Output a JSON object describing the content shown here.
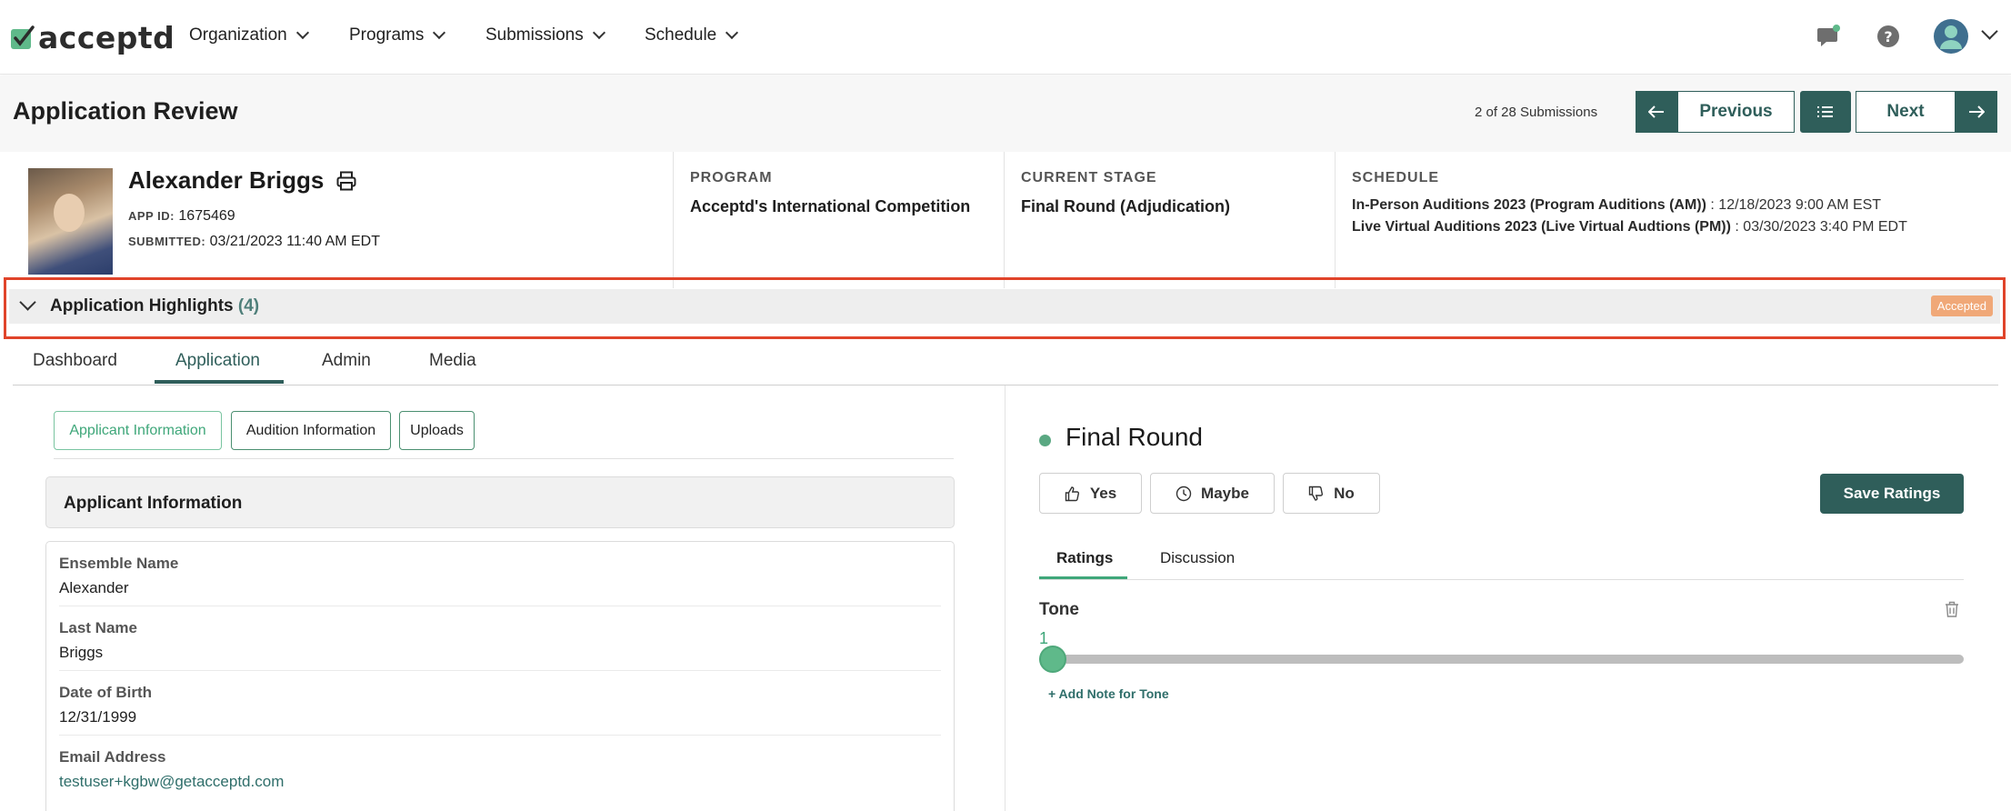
{
  "brand": {
    "name": "acceptd",
    "accent": "#2f5e5a",
    "check_color": "#5fb98a"
  },
  "nav": {
    "items": [
      "Organization",
      "Programs",
      "Submissions",
      "Schedule"
    ]
  },
  "header": {
    "title": "Application Review",
    "submission_count": "2 of 28 Submissions",
    "previous_label": "Previous",
    "next_label": "Next"
  },
  "applicant": {
    "name": "Alexander Briggs",
    "app_id_label": "APP ID:",
    "app_id": "1675469",
    "submitted_label": "SUBMITTED:",
    "submitted": "03/21/2023 11:40 AM EDT"
  },
  "program": {
    "label": "PROGRAM",
    "value": "Acceptd's International Competition"
  },
  "stage": {
    "label": "CURRENT STAGE",
    "value": "Final Round (Adjudication)"
  },
  "schedule": {
    "label": "SCHEDULE",
    "lines": [
      {
        "event": "In-Person Auditions 2023 (Program Auditions (AM))",
        "time": " : 12/18/2023 9:00 AM EST"
      },
      {
        "event": "Live Virtual Auditions 2023 (Live Virtual Audtions (PM))",
        "time": " : 03/30/2023 3:40 PM EDT"
      }
    ]
  },
  "highlights": {
    "title": "Application Highlights",
    "count": "(4)",
    "badge": "Accepted",
    "badge_color": "#f0a878"
  },
  "tabs": [
    "Dashboard",
    "Application",
    "Admin",
    "Media"
  ],
  "active_tab": "Application",
  "subtabs": [
    "Applicant Information",
    "Audition Information",
    "Uploads"
  ],
  "section_title": "Applicant Information",
  "fields": [
    {
      "label": "Ensemble Name",
      "value": "Alexander"
    },
    {
      "label": "Last Name",
      "value": "Briggs"
    },
    {
      "label": "Date of Birth",
      "value": "12/31/1999"
    },
    {
      "label": "Email Address",
      "value": "testuser+kgbw@getacceptd.com"
    }
  ],
  "rating": {
    "round_title": "Final Round",
    "votes": [
      "Yes",
      "Maybe",
      "No"
    ],
    "save_label": "Save Ratings",
    "tabs": [
      "Ratings",
      "Discussion"
    ],
    "criterion": "Tone",
    "value": "1",
    "value_fraction": 0,
    "add_note": "+ Add Note for Tone"
  }
}
